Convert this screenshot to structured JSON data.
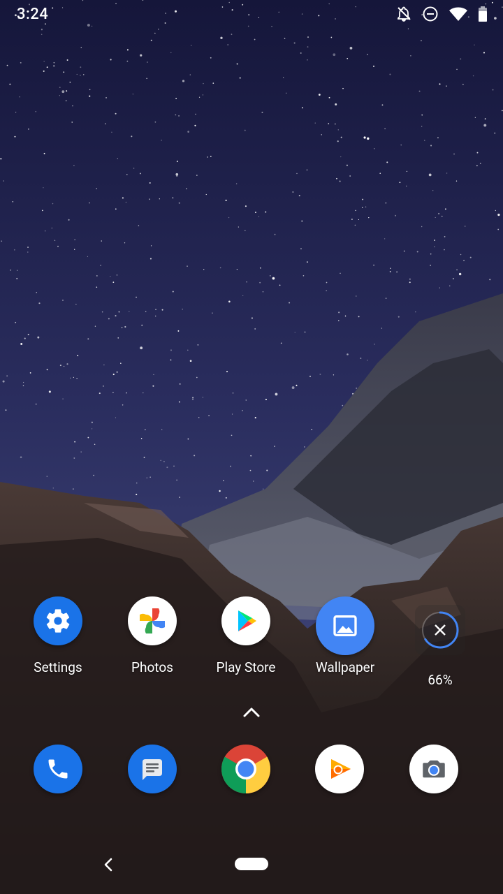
{
  "status_bar": {
    "time": "3:24",
    "icons": [
      "notifications-off-icon",
      "do-not-disturb-icon",
      "wifi-icon",
      "battery-icon"
    ]
  },
  "home_row": [
    {
      "label": "Settings",
      "icon": "settings-icon",
      "bg": "#1a73e8"
    },
    {
      "label": "Photos",
      "icon": "photos-pinwheel-icon",
      "bg": "#ffffff"
    },
    {
      "label": "Play Store",
      "icon": "play-store-icon",
      "bg": "#ffffff"
    },
    {
      "label": "Wallpaper",
      "icon": "wallpaper-icon",
      "bg": "#4285f4"
    }
  ],
  "installing_app": {
    "progress_label": "66%",
    "progress": 0.66,
    "icon": "cancel-install-icon"
  },
  "dock": [
    {
      "name": "phone",
      "icon": "phone-icon",
      "bg": "#1a73e8"
    },
    {
      "name": "messages",
      "icon": "messages-icon",
      "bg": "#1a73e8"
    },
    {
      "name": "chrome",
      "icon": "chrome-icon",
      "bg": "#ffffff"
    },
    {
      "name": "play-music",
      "icon": "play-music-icon",
      "bg": "#ffffff"
    },
    {
      "name": "camera",
      "icon": "camera-icon",
      "bg": "#ffffff"
    }
  ],
  "nav": {
    "back_icon": "back-chevron-icon",
    "home_icon": "home-pill-icon",
    "app_drawer_icon": "chevron-up-icon"
  }
}
